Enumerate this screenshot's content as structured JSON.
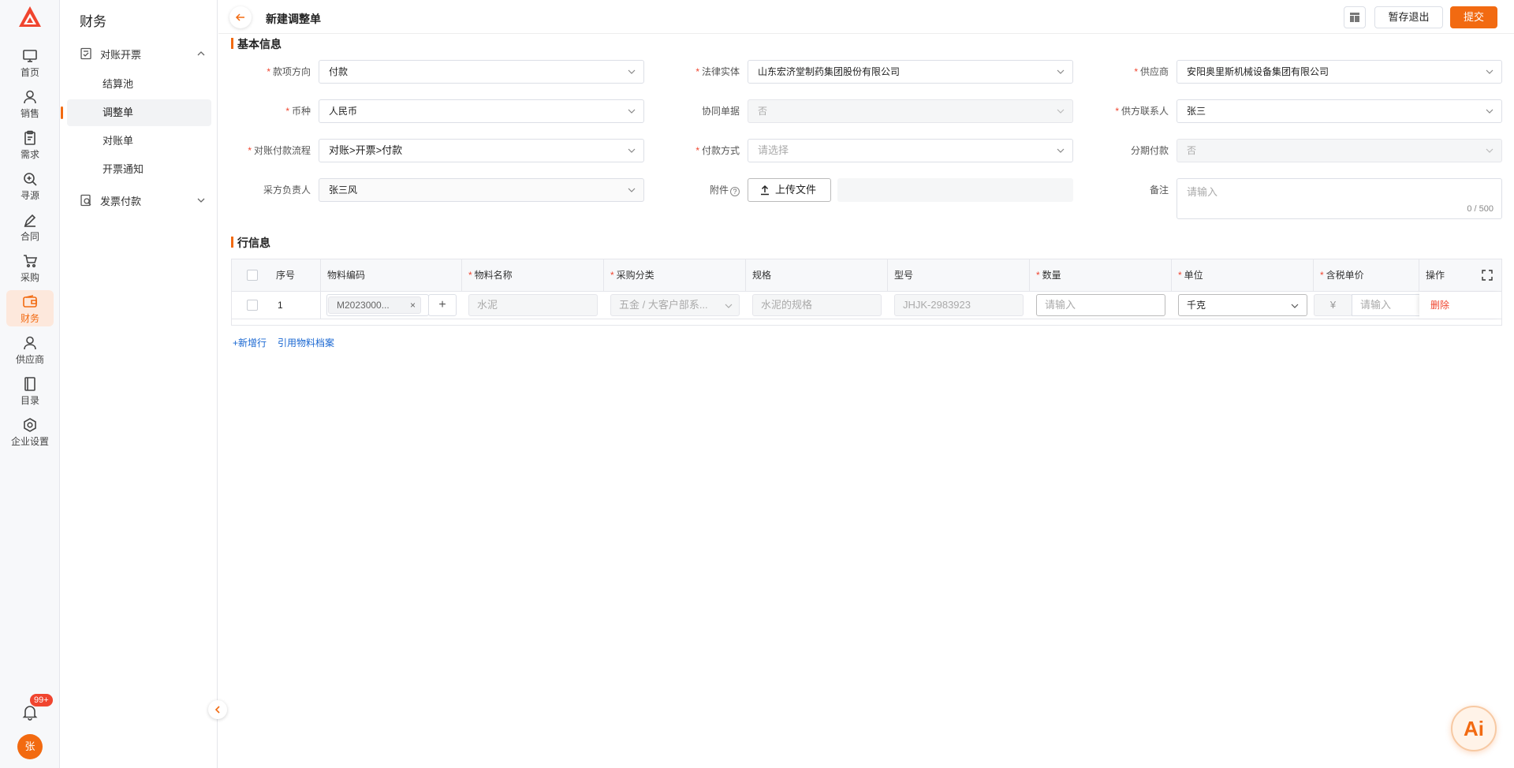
{
  "rail": {
    "items": [
      {
        "label": "首页",
        "icon": "monitor-icon"
      },
      {
        "label": "销售",
        "icon": "user-icon"
      },
      {
        "label": "需求",
        "icon": "clipboard-icon"
      },
      {
        "label": "寻源",
        "icon": "search-plus-icon"
      },
      {
        "label": "合同",
        "icon": "pen-icon"
      },
      {
        "label": "采购",
        "icon": "cart-icon"
      },
      {
        "label": "财务",
        "icon": "wallet-icon"
      },
      {
        "label": "供应商",
        "icon": "user-icon"
      },
      {
        "label": "目录",
        "icon": "book-icon"
      },
      {
        "label": "企业设置",
        "icon": "gear-icon"
      }
    ],
    "active_label": "财务",
    "notification_badge": "99+",
    "avatar_text": "张"
  },
  "subnav": {
    "title": "财务",
    "group1": "对账开票",
    "items": [
      "结算池",
      "调整单",
      "对账单",
      "开票通知"
    ],
    "active_item": "调整单",
    "group2": "发票付款"
  },
  "header": {
    "title": "新建调整单",
    "save_exit_label": "暂存退出",
    "submit_label": "提交"
  },
  "basic_section": {
    "title": "基本信息",
    "fields": {
      "payment_direction": {
        "label": "款项方向",
        "value": "付款"
      },
      "legal_entity": {
        "label": "法律实体",
        "value": "山东宏济堂制药集团股份有限公司"
      },
      "supplier": {
        "label": "供应商",
        "value": "安阳奥里斯机械设备集团有限公司"
      },
      "currency": {
        "label": "币种",
        "value": "人民币"
      },
      "collab_doc": {
        "label": "协同单据",
        "value": "否"
      },
      "supplier_contact": {
        "label": "供方联系人",
        "value": "张三"
      },
      "flow": {
        "label": "对账付款流程",
        "value": "对账>开票>付款"
      },
      "pay_method": {
        "label": "付款方式",
        "placeholder": "请选择"
      },
      "installment": {
        "label": "分期付款",
        "value": "否"
      },
      "buyer_owner": {
        "label": "采方负责人",
        "value": "张三风"
      },
      "attachment": {
        "label": "附件",
        "button": "上传文件"
      },
      "remark": {
        "label": "备注",
        "placeholder": "请输入",
        "count": "0 / 500"
      }
    }
  },
  "lines_section": {
    "title": "行信息",
    "columns": [
      "序号",
      "物料编码",
      "物料名称",
      "采购分类",
      "规格",
      "型号",
      "数量",
      "单位",
      "含税单价",
      "操作"
    ],
    "row": {
      "index": "1",
      "material_code": "M2023000...",
      "material_name": "水泥",
      "category": "五金 / 大客户部系...",
      "spec": "水泥的规格",
      "model": "JHJK-2983923",
      "qty_placeholder": "请输入",
      "unit": "千克",
      "currency_symbol": "¥",
      "price_placeholder": "请输入",
      "delete_label": "删除"
    },
    "add_row_label": "+新增行",
    "ref_material_label": "引用物料档案"
  },
  "ai_label": "Ai",
  "colors": {
    "accent": "#f26a11",
    "danger": "#f0452f",
    "link": "#1967d2"
  }
}
